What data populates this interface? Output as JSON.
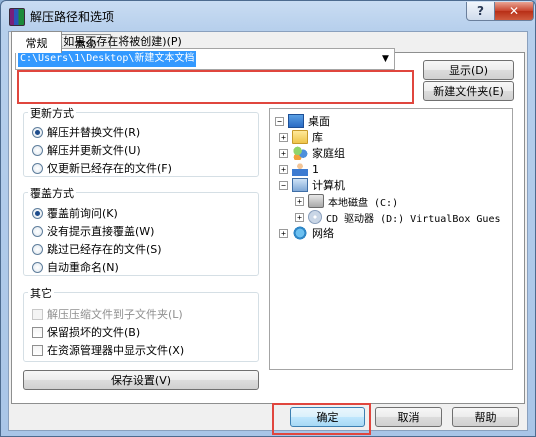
{
  "window": {
    "title": "解压路径和选项",
    "help_glyph": "?",
    "close_glyph": "✕"
  },
  "tabs": [
    {
      "label": "常规",
      "active": true
    },
    {
      "label": "高级",
      "active": false
    }
  ],
  "destination": {
    "label": "目标路径(如果不存在将被创建)(P)",
    "value": "C:\\Users\\1\\Desktop\\新建文本文档",
    "show_button": "显示(D)",
    "new_folder_button": "新建文件夹(E)"
  },
  "update_mode": {
    "title": "更新方式",
    "options": [
      {
        "label": "解压并替换文件(R)",
        "selected": true
      },
      {
        "label": "解压并更新文件(U)",
        "selected": false
      },
      {
        "label": "仅更新已经存在的文件(F)",
        "selected": false
      }
    ]
  },
  "overwrite_mode": {
    "title": "覆盖方式",
    "options": [
      {
        "label": "覆盖前询问(K)",
        "selected": true
      },
      {
        "label": "没有提示直接覆盖(W)",
        "selected": false
      },
      {
        "label": "跳过已经存在的文件(S)",
        "selected": false
      },
      {
        "label": "自动重命名(N)",
        "selected": false
      }
    ]
  },
  "misc": {
    "title": "其它",
    "options": [
      {
        "label": "解压压缩文件到子文件夹(L)",
        "checked": false,
        "enabled": false
      },
      {
        "label": "保留损坏的文件(B)",
        "checked": false,
        "enabled": true
      },
      {
        "label": "在资源管理器中显示文件(X)",
        "checked": false,
        "enabled": true
      }
    ]
  },
  "save_settings_button": "保存设置(V)",
  "tree": {
    "items": [
      {
        "label": "桌面",
        "icon": "desktop-icon",
        "expander": "−"
      },
      {
        "label": "库",
        "icon": "library-icon",
        "expander": "+"
      },
      {
        "label": "家庭组",
        "icon": "homegroup-icon",
        "expander": "+"
      },
      {
        "label": "1",
        "icon": "user-icon",
        "expander": "+"
      },
      {
        "label": "计算机",
        "icon": "computer-icon",
        "expander": "−"
      },
      {
        "label": "本地磁盘 (C:)",
        "icon": "disk-icon",
        "expander": "+"
      },
      {
        "label": "CD 驱动器 (D:) VirtualBox Gues",
        "icon": "cd-drive-icon",
        "expander": "+"
      },
      {
        "label": "网络",
        "icon": "network-icon",
        "expander": "+"
      }
    ]
  },
  "footer": {
    "ok_button": "确定",
    "cancel_button": "取消",
    "help_button": "帮助"
  }
}
